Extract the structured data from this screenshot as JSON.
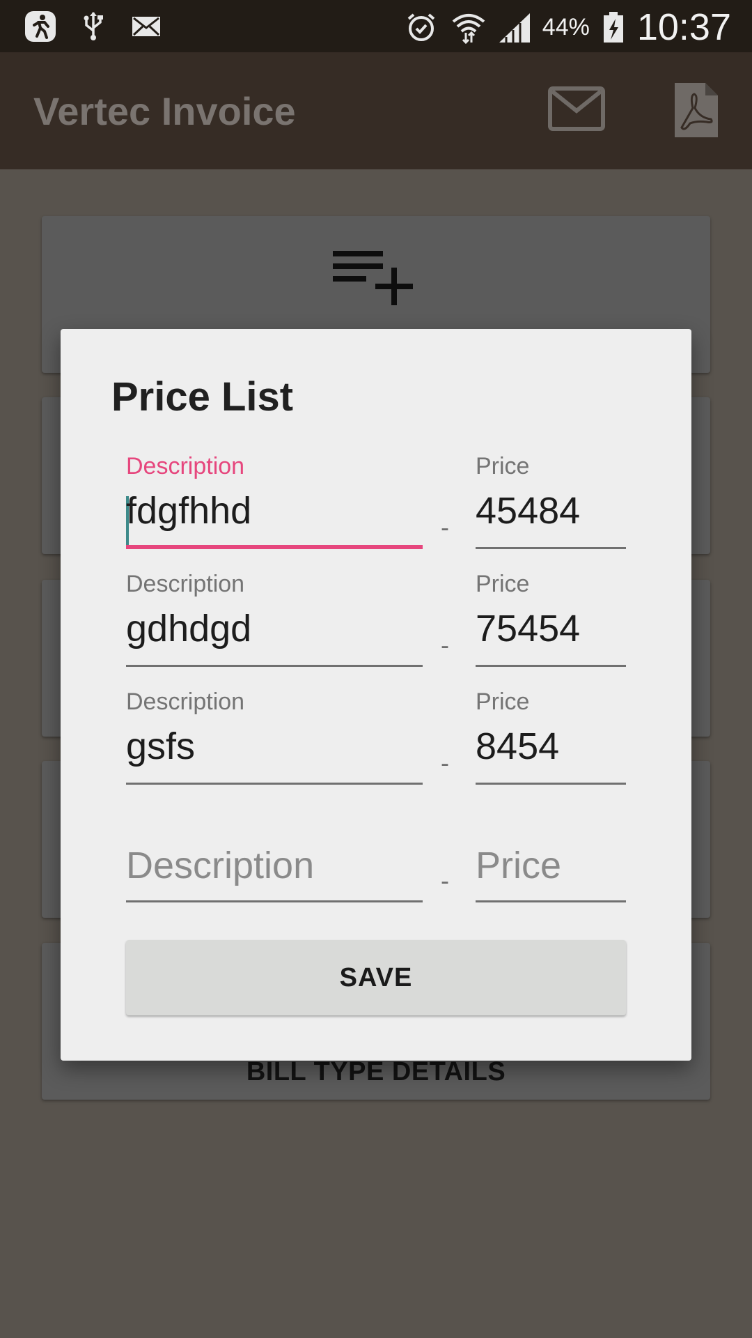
{
  "status_bar": {
    "icons_left": [
      "runner-icon",
      "usb-icon",
      "mail-icon"
    ],
    "icons_right": [
      "alarm-icon",
      "wifi-icon",
      "signal-icon",
      "battery-icon"
    ],
    "battery_percent": "44%",
    "time": "10:37"
  },
  "app_bar": {
    "title": "Vertec Invoice",
    "actions": [
      "mail-icon",
      "pdf-icon"
    ]
  },
  "background_cards": {
    "first_card_icon": "playlist-add-icon",
    "bottom_card_label": "BILL TYPE DETAILS"
  },
  "dialog": {
    "title": "Price List",
    "separator": "-",
    "rows": [
      {
        "description_label": "Description",
        "description_value": "fdgfhhd",
        "price_label": "Price",
        "price_value": "45484",
        "focused": true
      },
      {
        "description_label": "Description",
        "description_value": "gdhdgd",
        "price_label": "Price",
        "price_value": "75454",
        "focused": false
      },
      {
        "description_label": "Description",
        "description_value": "gsfs",
        "price_label": "Price",
        "price_value": "8454",
        "focused": false
      }
    ],
    "new_row": {
      "description_placeholder": "Description",
      "price_placeholder": "Price"
    },
    "save_label": "SAVE"
  },
  "colors": {
    "status_bar": "#221c16",
    "app_bar": "#362c25",
    "accent_focus": "#e6467d",
    "dialog_bg": "#eeeeee",
    "save_button": "#d9dad8"
  }
}
